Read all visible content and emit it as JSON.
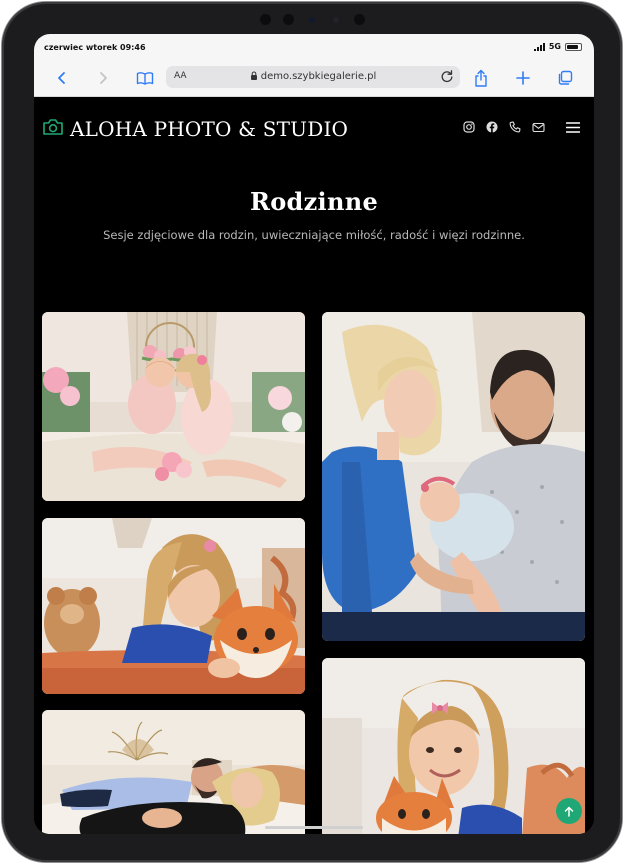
{
  "status_bar": {
    "time": "czerwiec wtorek 09:46",
    "network": "5G"
  },
  "browser": {
    "text_size_button": "AA",
    "url": "demo.szybkiegalerie.pl",
    "icons": [
      "back-chevron-icon",
      "forward-chevron-icon",
      "bookmarks-book-icon",
      "lock-icon",
      "reload-icon",
      "share-icon",
      "new-tab-plus-icon",
      "tabs-icon"
    ]
  },
  "site": {
    "brand": "ALOHA PHOTO & STUDIO",
    "brand_icon": "camera-icon",
    "accent_color": "#1fa876",
    "social_icons": [
      "instagram-icon",
      "facebook-icon",
      "phone-icon",
      "mail-icon",
      "menu-icon"
    ]
  },
  "hero": {
    "title": "Rodzinne",
    "subtitle": "Sesje zdjęciowe dla rodzin, uwieczniające miłość, radość i więzi rodzinne."
  },
  "gallery": {
    "photos": [
      {
        "id": "sisters-flower-hoop",
        "subject": "two little girls hugging on a bed with pink flowers"
      },
      {
        "id": "parents-newborn",
        "subject": "mother and father holding a newborn baby"
      },
      {
        "id": "girl-fox-plush-lying",
        "subject": "smiling girl lying with a fox plush toy"
      },
      {
        "id": "couple-pregnancy",
        "subject": "couple lying together, pregnancy session"
      },
      {
        "id": "girl-fox-plush-close",
        "subject": "girl with a pink bow hugging a fox plush"
      }
    ]
  },
  "back_to_top": {
    "icon": "arrow-up-icon"
  }
}
